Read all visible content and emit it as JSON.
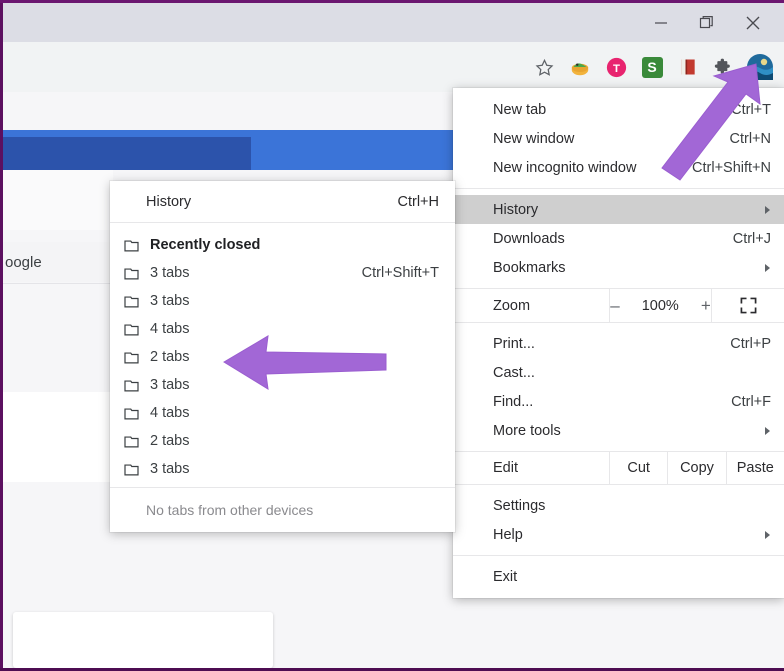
{
  "window": {
    "controls": [
      {
        "name": "minimize",
        "glyph": "minimize-icon"
      },
      {
        "name": "restore",
        "glyph": "restore-icon"
      },
      {
        "name": "close",
        "glyph": "close-icon"
      }
    ]
  },
  "toolbar": {
    "icons": [
      {
        "name": "bookmark-star-icon",
        "label": "☆"
      },
      {
        "name": "extension-honey-icon",
        "label": "🍯"
      },
      {
        "name": "extension-t-icon",
        "label": "T"
      },
      {
        "name": "extension-s-icon",
        "label": "S"
      },
      {
        "name": "extension-book-icon",
        "label": "📕"
      },
      {
        "name": "extensions-puzzle-icon",
        "label": "🧩"
      },
      {
        "name": "profile-avatar-icon",
        "label": "🌊"
      },
      {
        "name": "chrome-menu-icon",
        "label": "⋮"
      }
    ]
  },
  "page": {
    "partial_text": "oogle"
  },
  "menu": {
    "items": [
      {
        "label": "New tab",
        "accel": "Ctrl+T",
        "caret": false,
        "highlight": false,
        "name": "menu-item-new-tab"
      },
      {
        "label": "New window",
        "accel": "Ctrl+N",
        "caret": false,
        "highlight": false,
        "name": "menu-item-new-window"
      },
      {
        "label": "New incognito window",
        "accel": "Ctrl+Shift+N",
        "caret": false,
        "highlight": false,
        "name": "menu-item-new-incognito-window"
      }
    ],
    "items2": [
      {
        "label": "History",
        "accel": "",
        "caret": true,
        "highlight": true,
        "name": "menu-item-history"
      },
      {
        "label": "Downloads",
        "accel": "Ctrl+J",
        "caret": false,
        "highlight": false,
        "name": "menu-item-downloads"
      },
      {
        "label": "Bookmarks",
        "accel": "",
        "caret": true,
        "highlight": false,
        "name": "menu-item-bookmarks"
      }
    ],
    "zoom": {
      "label": "Zoom",
      "minus": "–",
      "value": "100%",
      "plus": "+",
      "fullscreen_icon": "fullscreen-icon"
    },
    "items3": [
      {
        "label": "Print...",
        "accel": "Ctrl+P",
        "caret": false,
        "highlight": false,
        "name": "menu-item-print"
      },
      {
        "label": "Cast...",
        "accel": "",
        "caret": false,
        "highlight": false,
        "name": "menu-item-cast"
      },
      {
        "label": "Find...",
        "accel": "Ctrl+F",
        "caret": false,
        "highlight": false,
        "name": "menu-item-find"
      },
      {
        "label": "More tools",
        "accel": "",
        "caret": true,
        "highlight": false,
        "name": "menu-item-more-tools"
      }
    ],
    "edit_row": {
      "label": "Edit",
      "cut": "Cut",
      "copy": "Copy",
      "paste": "Paste"
    },
    "items4": [
      {
        "label": "Settings",
        "accel": "",
        "caret": false,
        "highlight": false,
        "name": "menu-item-settings"
      },
      {
        "label": "Help",
        "accel": "",
        "caret": true,
        "highlight": false,
        "name": "menu-item-help"
      }
    ],
    "items5": [
      {
        "label": "Exit",
        "accel": "",
        "caret": false,
        "highlight": false,
        "name": "menu-item-exit"
      }
    ]
  },
  "history_submenu": {
    "header": {
      "label": "History",
      "accel": "Ctrl+H"
    },
    "rows": [
      {
        "label": "Recently closed",
        "accel": "",
        "bold": true,
        "name": "history-recently-closed"
      },
      {
        "label": "3 tabs",
        "accel": "Ctrl+Shift+T",
        "bold": false,
        "name": "history-tab-group"
      },
      {
        "label": "3 tabs",
        "accel": "",
        "bold": false,
        "name": "history-tab-group"
      },
      {
        "label": "4 tabs",
        "accel": "",
        "bold": false,
        "name": "history-tab-group"
      },
      {
        "label": "2 tabs",
        "accel": "",
        "bold": false,
        "name": "history-tab-group"
      },
      {
        "label": "3 tabs",
        "accel": "",
        "bold": false,
        "name": "history-tab-group"
      },
      {
        "label": "4 tabs",
        "accel": "",
        "bold": false,
        "name": "history-tab-group"
      },
      {
        "label": "2 tabs",
        "accel": "",
        "bold": false,
        "name": "history-tab-group"
      },
      {
        "label": "3 tabs",
        "accel": "",
        "bold": false,
        "name": "history-tab-group"
      }
    ],
    "footer": "No tabs from other devices"
  },
  "annotations": {
    "arrow_color": "#a267d6",
    "arrows": [
      {
        "name": "annotation-arrow-to-menu",
        "direction": "up-right"
      },
      {
        "name": "annotation-arrow-to-tab-group",
        "direction": "left"
      }
    ]
  },
  "colors": {
    "titlebar": "#dcdde5",
    "toolbar": "#f1f3f4",
    "blue_dark": "#2c53ab",
    "blue_light": "#3b74d8",
    "highlight": "#cfcfcf",
    "frame": "#5c1060"
  }
}
